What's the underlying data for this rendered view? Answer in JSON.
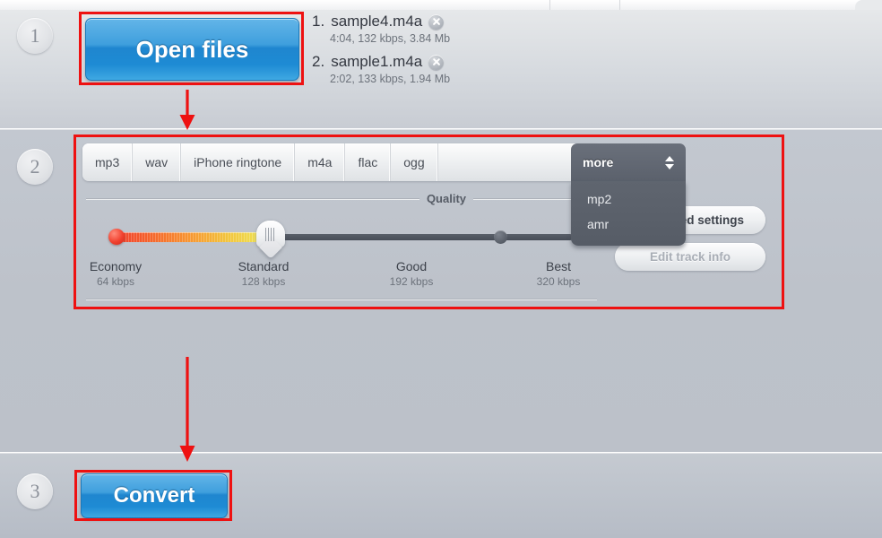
{
  "app": {
    "background_top": "#d0d4d9",
    "accent_blue": "#3f9fdd",
    "annotation_red": "#ee1111"
  },
  "steps": {
    "one": "1",
    "two": "2",
    "three": "3"
  },
  "step1": {
    "open_files_label": "Open files",
    "files": [
      {
        "index": "1.",
        "name": "sample4.m4a",
        "meta": "4:04, 132 kbps, 3.84 Mb",
        "remove_icon": "close-circle-icon"
      },
      {
        "index": "2.",
        "name": "sample1.m4a",
        "meta": "2:02, 133 kbps, 1.94 Mb",
        "remove_icon": "close-circle-icon"
      }
    ]
  },
  "step2": {
    "format_tabs": [
      {
        "label": "mp3",
        "active": false
      },
      {
        "label": "wav",
        "active": false
      },
      {
        "label": "iPhone ringtone",
        "active": false
      },
      {
        "label": "m4a",
        "active": false
      },
      {
        "label": "flac",
        "active": false
      },
      {
        "label": "ogg",
        "active": false
      }
    ],
    "more": {
      "label": "more",
      "active": true,
      "spinner_icon": "spinner-up-down-icon",
      "items": [
        {
          "label": "mp2"
        },
        {
          "label": "amr"
        }
      ]
    },
    "quality": {
      "title": "Quality",
      "selected": "Standard",
      "selected_bitrate": "128 kbps",
      "stops": [
        {
          "label": "Economy",
          "bitrate": "64 kbps"
        },
        {
          "label": "Standard",
          "bitrate": "128 kbps"
        },
        {
          "label": "Good",
          "bitrate": "192 kbps"
        },
        {
          "label": "Best",
          "bitrate": "320 kbps"
        }
      ]
    },
    "advanced_settings_label": "Advanced settings",
    "edit_track_info_label": "Edit track info"
  },
  "step3": {
    "convert_label": "Convert"
  }
}
